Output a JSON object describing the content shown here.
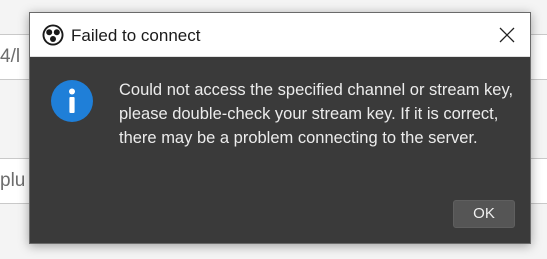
{
  "background": {
    "field_one_text": "4/l",
    "field_two_text": "plu"
  },
  "dialog": {
    "title": "Failed to connect",
    "app_icon": "obs-logo-icon",
    "close_icon": "close-icon",
    "info_icon": "information-icon",
    "message": "Could not access the specified channel or stream key, please double-check your stream key. If it is correct, there may be a problem connecting to the server.",
    "ok_label": "OK"
  },
  "colors": {
    "dialog_bg": "#3a3a3a",
    "titlebar_bg": "#ffffff",
    "info_blue": "#1f7fd8",
    "button_bg": "#555555",
    "text_light": "#ececec"
  }
}
